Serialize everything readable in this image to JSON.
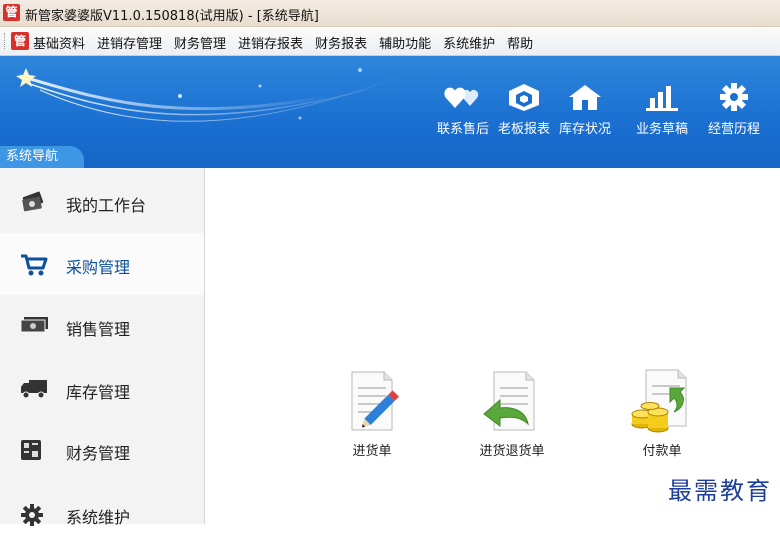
{
  "window": {
    "app_icon_char": "管",
    "title": "新管家婆婆版V11.0.150818(试用版) - [系统导航]"
  },
  "menu": {
    "logo_char": "管",
    "items": [
      "基础资料",
      "进销存管理",
      "财务管理",
      "进销存报表",
      "财务报表",
      "辅助功能",
      "系统维护",
      "帮助"
    ]
  },
  "banner": {
    "nav_tab_label": "系统导航",
    "tools": [
      {
        "label": "联系售后",
        "icon": "hearts-icon"
      },
      {
        "label": "老板报表",
        "icon": "cube-icon"
      },
      {
        "label": "库存状况",
        "icon": "house-icon"
      },
      {
        "label": "业务草稿",
        "icon": "bar-chart-icon"
      },
      {
        "label": "经营历程",
        "icon": "gear-icon"
      }
    ]
  },
  "sidebar": {
    "items": [
      {
        "label": "我的工作台",
        "icon": "money-stack-icon",
        "active": false
      },
      {
        "label": "采购管理",
        "icon": "shopping-cart-icon",
        "active": true
      },
      {
        "label": "销售管理",
        "icon": "cash-icon",
        "active": false
      },
      {
        "label": "库存管理",
        "icon": "truck-icon",
        "active": false
      },
      {
        "label": "财务管理",
        "icon": "calculator-icon",
        "active": false
      },
      {
        "label": "系统维护",
        "icon": "gear-icon",
        "active": false
      }
    ]
  },
  "main": {
    "documents": [
      {
        "label": "进货单",
        "icon": "document-pencil-icon"
      },
      {
        "label": "进货退货单",
        "icon": "document-return-icon"
      },
      {
        "label": "付款单",
        "icon": "document-coins-icon"
      }
    ]
  },
  "watermark": "最需教育",
  "colors": {
    "banner": "#1a6fd0",
    "active_label": "#0d4f9e",
    "sidebar_bg": "#f3f3f3"
  }
}
